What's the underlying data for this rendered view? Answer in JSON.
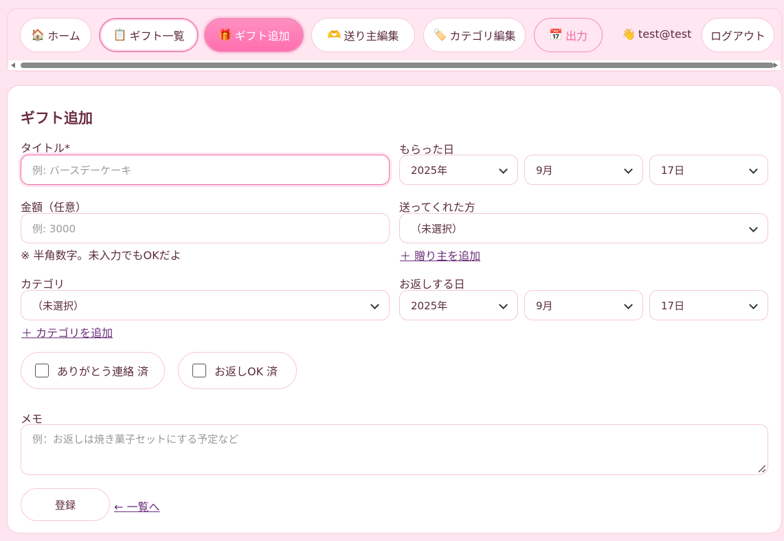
{
  "nav": {
    "home": {
      "icon": "house-icon",
      "glyph": "🏠",
      "label": "ホーム"
    },
    "list": {
      "icon": "clipboard-icon",
      "glyph": "📋",
      "label": "ギフト一覧"
    },
    "add": {
      "icon": "gift-icon",
      "glyph": "🎁",
      "label": "ギフト追加"
    },
    "senders": {
      "icon": "heart-hands-icon",
      "glyph": "🫶",
      "label": "送り主編集"
    },
    "categories": {
      "icon": "tag-icon",
      "glyph": "🏷️",
      "label": "カテゴリ編集"
    },
    "export": {
      "icon": "calendar-icon",
      "glyph": "📅",
      "label": "出力"
    },
    "user": {
      "icon": "waving-hand-icon",
      "glyph": "👋",
      "label": "test@test"
    },
    "logout": {
      "label": "ログアウト"
    }
  },
  "form": {
    "title": "ギフト追加",
    "title_field": {
      "label": "タイトル*",
      "placeholder": "例: バースデーケーキ",
      "value": ""
    },
    "received_date": {
      "label": "もらった日",
      "year": "2025年",
      "month": "9月",
      "day": "17日"
    },
    "amount": {
      "label": "金額（任意）",
      "placeholder": "例: 3000",
      "hint": "※ 半角数字。未入力でもOKだよ"
    },
    "sender": {
      "label": "送ってくれた方",
      "value": "（未選択）",
      "add_link": "＋ 贈り主を追加"
    },
    "category": {
      "label": "カテゴリ",
      "value": "（未選択）",
      "add_link": "＋ カテゴリを追加"
    },
    "return_date": {
      "label": "お返しする日",
      "year": "2025年",
      "month": "9月",
      "day": "17日"
    },
    "thanks_check": {
      "label": "ありがとう連絡 済",
      "checked": false
    },
    "return_check": {
      "label": "お返しOK 済",
      "checked": false
    },
    "memo": {
      "label": "メモ",
      "placeholder": "例：お返しは焼き菓子セットにする予定など"
    },
    "submit": "登録",
    "back_link": "← 一覧へ"
  },
  "colors": {
    "accent": "#ff6fae",
    "background": "#fde4ef",
    "border": "#f5c7da",
    "text": "#5a2a3e"
  }
}
